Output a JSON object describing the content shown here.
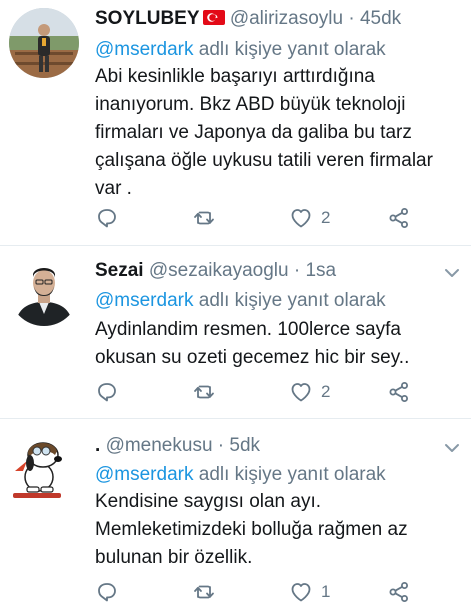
{
  "tweets": [
    {
      "name": "SOYLUBEY",
      "handle": "@alirizasoylu",
      "separator": "·",
      "time": "45dk",
      "reply_mention": "@mserdark",
      "reply_text": " adlı kişiye yanıt olarak",
      "lines": [
        "Abi kesinlikle başarıyı arttırdığına",
        "inanıyorum. Bkz ABD büyük teknoloji",
        "firmaları ve Japonya da galiba bu tarz",
        "çalışana öğle uykusu tatili veren firmalar",
        "var ."
      ],
      "likes": "2",
      "icons": {
        "reply": "reply-icon",
        "retweet": "retweet-icon",
        "like": "heart-icon",
        "share": "share-icon"
      }
    },
    {
      "name": "Sezai",
      "handle": "@sezaikayaoglu",
      "separator": "·",
      "time": "1sa",
      "reply_mention": "@mserdark",
      "reply_text": " adlı kişiye yanıt olarak",
      "lines": [
        "Aydinlandim resmen. 100lerce sayfa",
        "okusan su ozeti gecemez hic bir sey.."
      ],
      "likes": "2"
    },
    {
      "name": ".",
      "handle": "@menekusu",
      "separator": "·",
      "time": "5dk",
      "reply_mention": "@mserdark",
      "reply_text": " adlı kişiye yanıt olarak",
      "lines": [
        "Kendisine saygısı olan ayı.",
        "Memleketimizdeki bolluğa rağmen az",
        "bulunan bir özellik."
      ],
      "likes": "1"
    }
  ],
  "colors": {
    "link": "#1b95e0",
    "secondary": "#657786",
    "text": "#14171a",
    "divider": "#e6ecf0"
  }
}
